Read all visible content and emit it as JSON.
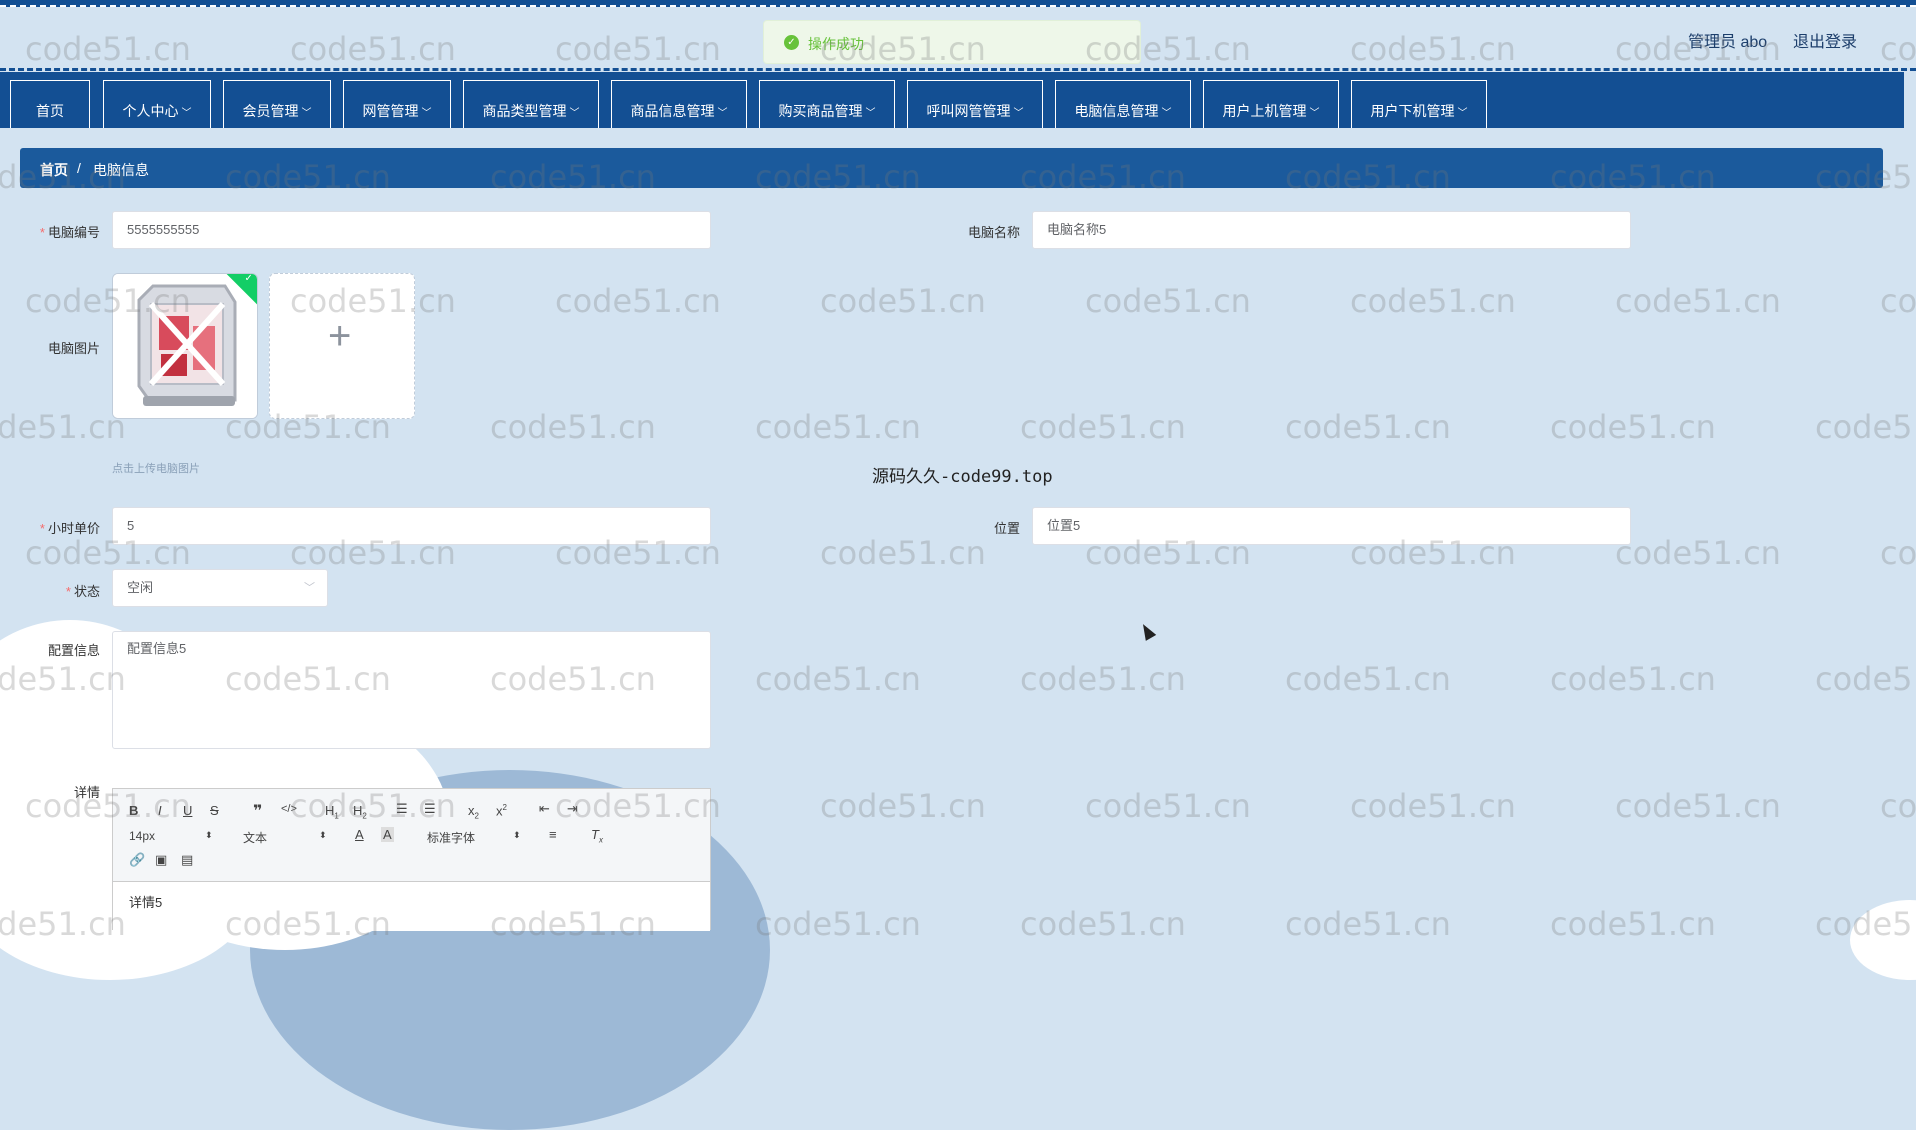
{
  "header": {
    "user_info": "管理员 abo",
    "logout": "退出登录"
  },
  "toast": {
    "icon": "success-check-icon",
    "message": "操作成功"
  },
  "nav": {
    "items": [
      {
        "label": "首页"
      },
      {
        "label": "个人中心"
      },
      {
        "label": "会员管理"
      },
      {
        "label": "网管管理"
      },
      {
        "label": "商品类型管理"
      },
      {
        "label": "商品信息管理"
      },
      {
        "label": "购买商品管理"
      },
      {
        "label": "呼叫网管管理"
      },
      {
        "label": "电脑信息管理"
      },
      {
        "label": "用户上机管理"
      },
      {
        "label": "用户下机管理"
      }
    ]
  },
  "breadcrumb": {
    "home": "首页",
    "separator": "/",
    "current": "电脑信息"
  },
  "form": {
    "computer_no_label": "电脑编号",
    "computer_no_value": "5555555555",
    "computer_name_label": "电脑名称",
    "computer_name_value": "电脑名称5",
    "image_label": "电脑图片",
    "upload_hint": "点击上传电脑图片",
    "price_label": "小时单价",
    "price_value": "5",
    "location_label": "位置",
    "location_value": "位置5",
    "status_label": "状态",
    "status_value": "空闲",
    "config_label": "配置信息",
    "config_value": "配置信息5",
    "detail_label": "详情",
    "detail_value": "详情5"
  },
  "editor": {
    "font_size": "14px",
    "header_select": "文本",
    "font_family": "标准字体"
  },
  "watermark": {
    "text": "code51.cn",
    "center": "源码久久-code99.top"
  }
}
